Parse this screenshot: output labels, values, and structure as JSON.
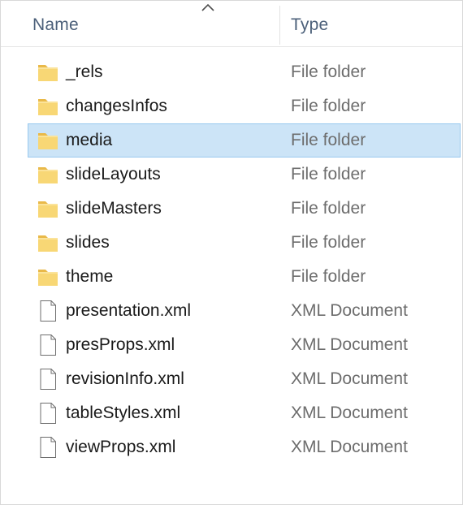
{
  "header": {
    "name_label": "Name",
    "type_label": "Type",
    "sort_icon": "chevron-up-icon"
  },
  "colors": {
    "folder": "#f8d775",
    "selection": "#cce4f7",
    "header_text": "#4c607a"
  },
  "items": [
    {
      "name": "_rels",
      "type": "File folder",
      "icon": "folder-icon",
      "selected": false
    },
    {
      "name": "changesInfos",
      "type": "File folder",
      "icon": "folder-icon",
      "selected": false
    },
    {
      "name": "media",
      "type": "File folder",
      "icon": "folder-icon",
      "selected": true
    },
    {
      "name": "slideLayouts",
      "type": "File folder",
      "icon": "folder-icon",
      "selected": false
    },
    {
      "name": "slideMasters",
      "type": "File folder",
      "icon": "folder-icon",
      "selected": false
    },
    {
      "name": "slides",
      "type": "File folder",
      "icon": "folder-icon",
      "selected": false
    },
    {
      "name": "theme",
      "type": "File folder",
      "icon": "folder-icon",
      "selected": false
    },
    {
      "name": "presentation.xml",
      "type": "XML Document",
      "icon": "document-icon",
      "selected": false
    },
    {
      "name": "presProps.xml",
      "type": "XML Document",
      "icon": "document-icon",
      "selected": false
    },
    {
      "name": "revisionInfo.xml",
      "type": "XML Document",
      "icon": "document-icon",
      "selected": false
    },
    {
      "name": "tableStyles.xml",
      "type": "XML Document",
      "icon": "document-icon",
      "selected": false
    },
    {
      "name": "viewProps.xml",
      "type": "XML Document",
      "icon": "document-icon",
      "selected": false
    }
  ]
}
